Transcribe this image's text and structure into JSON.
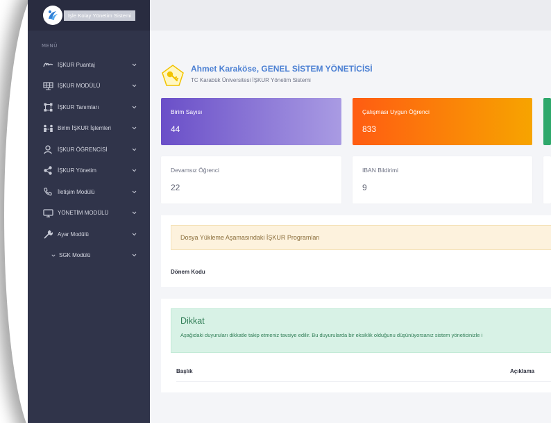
{
  "app": {
    "title": "İşle Kolay Yönetim Sistemi"
  },
  "sidebar": {
    "menu_header": "MENÜ",
    "items": [
      {
        "label": "İŞKUR Puantaj",
        "icon": "signature-icon"
      },
      {
        "label": "İŞKUR MODÜLÜ",
        "icon": "solar-panel-icon"
      },
      {
        "label": "İŞKUR Tanımları",
        "icon": "vector-square-icon"
      },
      {
        "label": "Birim İŞKUR İşlemleri",
        "icon": "people-link-icon"
      },
      {
        "label": "İŞKUR ÖĞRENCİSİ",
        "icon": "user-icon"
      },
      {
        "label": "İŞKUR Yönetim",
        "icon": "share-icon"
      },
      {
        "label": "İletişim Modülü",
        "icon": "phone-icon"
      },
      {
        "label": "YÖNETİM MODÜLÜ",
        "icon": "monitor-icon"
      },
      {
        "label": "Ayar Modülü",
        "icon": "wrench-icon"
      },
      {
        "label": "SGK Modülü",
        "icon": "chevron-small-icon"
      }
    ]
  },
  "welcome": {
    "name": "Ahmet Karaköse, GENEL SİSTEM YÖNETİCİSİ",
    "subtitle": "TC Karabük Üniversitesi İŞKUR Yönetim Sistemi",
    "icon": "key-icon"
  },
  "stats": {
    "birim_sayisi": {
      "label": "Birim Sayısı",
      "value": "44"
    },
    "calismasi_uygun": {
      "label": "Çalışması Uygun Öğrenci",
      "value": "833"
    },
    "devamsiz": {
      "label": "Devamsız Öğrenci",
      "value": "22"
    },
    "iban": {
      "label": "IBAN Bildirimi",
      "value": "9"
    }
  },
  "programs_panel": {
    "alert": "Dosya Yükleme Aşamasındaki İŞKUR Programları",
    "column": "Dönem Kodu"
  },
  "notice_panel": {
    "title": "Dikkat",
    "text": "Aşağıdaki duyuruları dikkatle takip etmeniz tavsiye edilir. Bu duyurularda bir eksiklik olduğunu düşünüyorsanız sistem yöneticinizle i",
    "col_title": "Başlık",
    "col_desc": "Açıklama"
  },
  "colors": {
    "sidebar": "#30344a",
    "accent_blue": "#4c80d3",
    "purple": "#6a4fc8",
    "orange": "#ff5c12",
    "green": "#2ea86b"
  }
}
